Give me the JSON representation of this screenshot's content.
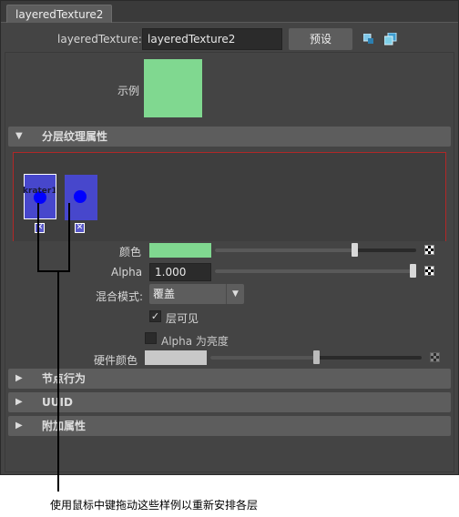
{
  "tab": {
    "label": "layeredTexture2"
  },
  "header": {
    "node_label": "layeredTexture:",
    "node_value": "layeredTexture2",
    "preset_button": "预设"
  },
  "sample": {
    "label": "示例",
    "color": "#80d890"
  },
  "sections": {
    "layered": "分层纹理属性",
    "node_behavior": "节点行为",
    "uuid": "UUID",
    "extra": "附加属性"
  },
  "layers": [
    {
      "name": "krater1"
    },
    {
      "name": ""
    }
  ],
  "attrs": {
    "color_label": "颜色",
    "color_value": "#80d890",
    "color_slider": 0.74,
    "alpha_label": "Alpha",
    "alpha_value": "1.000",
    "alpha_slider": 1.0,
    "blend_label": "混合模式:",
    "blend_value": "覆盖",
    "visible_label": "层可见",
    "alpha_luma_label": "Alpha 为亮度",
    "hw_color_label": "硬件颜色",
    "hw_color_value": "#c8c8c8",
    "hw_slider": 0.5
  },
  "annotation": {
    "caption": "使用鼠标中键拖动这些样例以重新安排各层"
  }
}
